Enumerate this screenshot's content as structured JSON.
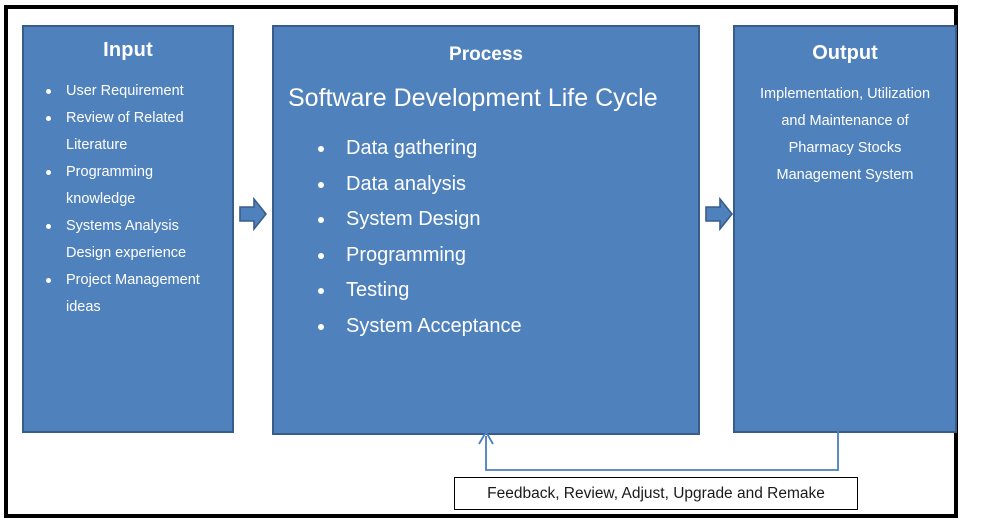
{
  "diagram": {
    "type": "input-process-output",
    "frame_color": "#000000",
    "panel_fill": "#4F81BD",
    "panel_border": "#385D8A",
    "connector_color": "#4F81BD",
    "text_color": "#FFFFFF"
  },
  "input": {
    "title": "Input",
    "items": [
      "User Requirement",
      "Review of Related Literature",
      "Programming knowledge",
      "Systems Analysis Design experience",
      "Project Management ideas"
    ]
  },
  "process": {
    "title": "Process",
    "subtitle": "Software Development Life Cycle",
    "items": [
      "Data gathering",
      "Data analysis",
      "System Design",
      "Programming",
      "Testing",
      "System Acceptance"
    ]
  },
  "output": {
    "title": "Output",
    "body": "Implementation, Utilization and Maintenance of Pharmacy Stocks Management System"
  },
  "feedback": {
    "label": "Feedback, Review, Adjust, Upgrade and Remake"
  },
  "arrows": {
    "input_to_process": "right-block-arrow",
    "process_to_output": "right-block-arrow",
    "output_to_process_feedback": "feedback-loop-arrow"
  }
}
